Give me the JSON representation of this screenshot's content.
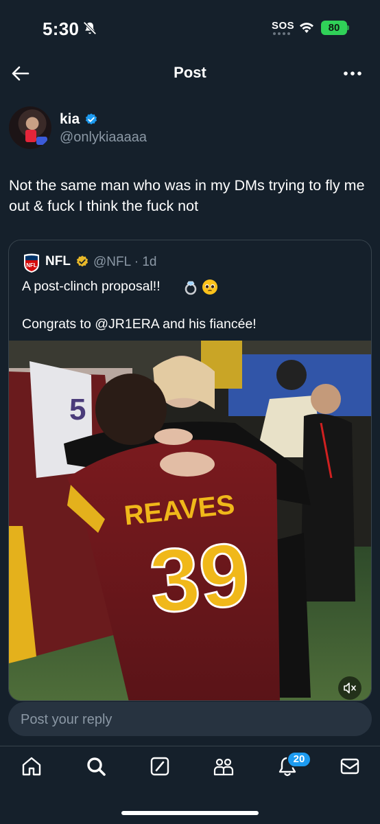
{
  "status_bar": {
    "time": "5:30",
    "sos": "SOS",
    "battery": "80"
  },
  "header": {
    "title": "Post"
  },
  "post": {
    "author_name": "kia",
    "author_handle": "@onlykiaaaaa",
    "text": "Not the same man who was in my DMs trying to fly me out & fuck I think the fuck not"
  },
  "quote": {
    "author_name": "NFL",
    "author_handle": "@NFL · 1d",
    "text_line1": "A post-clinch proposal!!",
    "text_line2": "Congrats to @JR1ERA and his fiancée!",
    "media": {
      "jersey_name": "REAVES",
      "jersey_number": "39",
      "banner_number": "5"
    }
  },
  "reply": {
    "placeholder": "Post your reply"
  },
  "nav": {
    "notification_count": "20"
  },
  "colors": {
    "background": "#15202b",
    "accent": "#1d9bf0",
    "secondary_text": "#8b98a5",
    "border": "#38444d",
    "battery_green": "#30d158",
    "gold_check": "#e8b829"
  }
}
